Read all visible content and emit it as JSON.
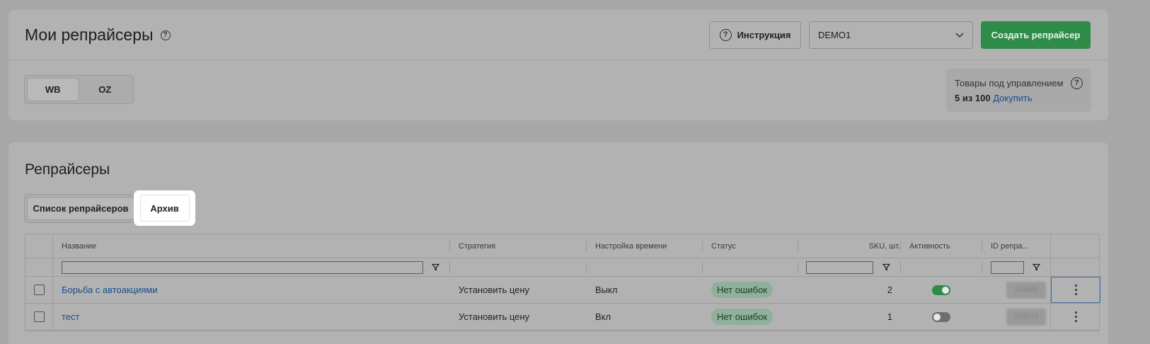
{
  "header": {
    "title": "Мои репрайсеры",
    "instruction_label": "Инструкция",
    "account_value": "DEMO1",
    "create_label": "Создать репрайсер"
  },
  "marketplaces": {
    "items": [
      "WB",
      "OZ"
    ],
    "selected": "WB"
  },
  "quota": {
    "label": "Товары под управлением",
    "value": "5 из 100",
    "buy_link": "Докупить"
  },
  "section": {
    "title": "Репрайсеры",
    "tabs": [
      "Список репрайсеров",
      "Архив"
    ],
    "highlighted_tab": "Архив"
  },
  "table": {
    "columns": {
      "name": "Название",
      "strategy": "Стратегия",
      "time": "Настройка времени",
      "status": "Статус",
      "sku": "SKU, шт.",
      "active": "Активность",
      "id": "ID репра..."
    },
    "rows": [
      {
        "name": "Борьба с автоакциями",
        "strategy": "Установить цену",
        "time": "Выкл",
        "status": "Нет ошибок",
        "sku": "2",
        "active": true,
        "id": "121833"
      },
      {
        "name": "тест",
        "strategy": "Установить цену",
        "time": "Вкл",
        "status": "Нет ошибок",
        "sku": "1",
        "active": false,
        "id": "120573"
      }
    ]
  },
  "colors": {
    "accent_green": "#2e8b48",
    "link_blue": "#174d8a",
    "badge_green": "#8fb09a"
  }
}
